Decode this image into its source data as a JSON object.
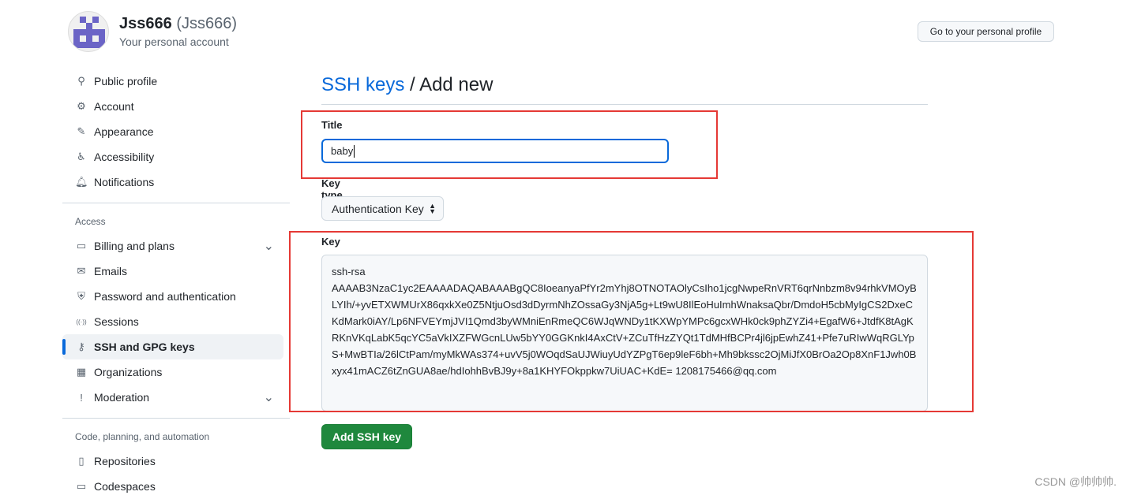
{
  "user": {
    "name": "Jss666",
    "login": "(Jss666)",
    "subtitle": "Your personal account",
    "profile_button": "Go to your personal profile"
  },
  "sidebar": {
    "items": [
      {
        "label": "Public profile",
        "icon": "person-icon"
      },
      {
        "label": "Account",
        "icon": "gear-icon"
      },
      {
        "label": "Appearance",
        "icon": "paintbrush-icon"
      },
      {
        "label": "Accessibility",
        "icon": "accessibility-icon"
      },
      {
        "label": "Notifications",
        "icon": "bell-icon"
      }
    ],
    "access_heading": "Access",
    "access_items": [
      {
        "label": "Billing and plans",
        "icon": "credit-card-icon"
      },
      {
        "label": "Emails",
        "icon": "mail-icon"
      },
      {
        "label": "Password and authentication",
        "icon": "shield-icon"
      },
      {
        "label": "Sessions",
        "icon": "broadcast-icon"
      },
      {
        "label": "SSH and GPG keys",
        "icon": "key-icon",
        "active": true
      },
      {
        "label": "Organizations",
        "icon": "organization-icon"
      },
      {
        "label": "Moderation",
        "icon": "report-icon"
      }
    ],
    "code_heading": "Code, planning, and automation",
    "code_items": [
      {
        "label": "Repositories",
        "icon": "repo-icon"
      },
      {
        "label": "Codespaces",
        "icon": "codespaces-icon"
      }
    ]
  },
  "main": {
    "breadcrumb_link": "SSH keys",
    "breadcrumb_sep": " / ",
    "breadcrumb_current": "Add new",
    "title_label": "Title",
    "title_value": "baby",
    "key_type_label": "Key type",
    "key_type_value": "Authentication Key",
    "key_label": "Key",
    "key_value": "ssh-rsa\nAAAAB3NzaC1yc2EAAAADAQABAAABgQC8IoeanyaPfYr2mYhj8OTNOTAOlyCsIho1jcgNwpeRnVRT6qrNnbzm8v94rhkVMOyBLYIh/+yvETXWMUrX86qxkXe0Z5NtjuOsd3dDyrmNhZOssaGy3NjA5g+Lt9wU8IlEoHuImhWnaksaQbr/DmdoH5cbMyIgCS2DxeCKdMark0iAY/Lp6NFVEYmjJVI1Qmd3byWMniEnRmeQC6WJqWNDy1tKXWpYMPc6gcxWHk0ck9phZYZi4+EgafW6+JtdfK8tAgKRKnVKqLabK5qcYC5aVkIXZFWGcnLUw5bYY0GGKnkI4AxCtV+ZCuTfHzZYQt1TdMHfBCPr4jl6jpEwhZ41+Pfe7uRIwWqRGLYpS+MwBTIa/26lCtPam/myMkWAs374+uvV5j0WOqdSaUJWiuyUdYZPgT6ep9leF6bh+Mh9bkssc2OjMiJfX0BrOa2Op8XnF1Jwh0Bxyx41mACZ6tZnGUA8ae/hdIohhBvBJ9y+8a1KHYFOkppkw7UiUAC+KdE= 1208175466@qq.com",
    "add_button": "Add SSH key"
  },
  "watermark": "CSDN @帅帅帅.",
  "colors": {
    "accent": "#0969da",
    "primary_button": "#1f883d",
    "highlight_box": "#e53935"
  }
}
